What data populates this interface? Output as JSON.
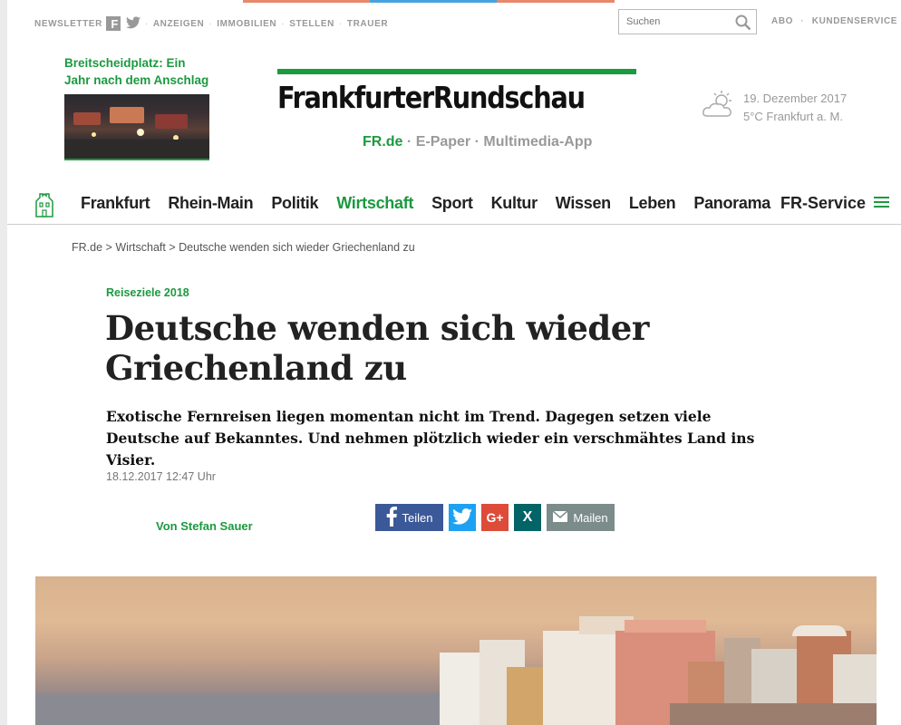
{
  "colors": {
    "accent": "#1b9a3f",
    "facebook": "#3b5998",
    "twitter": "#1da1f2",
    "googleplus": "#dd4b39",
    "xing": "#026466",
    "mail": "#7b8c8a"
  },
  "topbar": {
    "newsletter": "NEWSLETTER",
    "items": [
      "ANZEIGEN",
      "IMMOBILIEN",
      "STELLEN",
      "TRAUER"
    ],
    "search_placeholder": "Suchen",
    "abo": "ABO",
    "kundenservice": "KUNDENSERVICE"
  },
  "teaser": {
    "title": "Breitscheidplatz: Ein Jahr nach dem Anschlag"
  },
  "logo": {
    "name": "FrankfurterRundschau"
  },
  "sublinks": {
    "fr": "FR.de",
    "epaper": "E-Paper",
    "app": "Multimedia-App"
  },
  "weather": {
    "date": "19. Dezember 2017",
    "temp": "5°C Frankfurt a. M.",
    "icon": "partly-cloudy-icon"
  },
  "nav": {
    "items": [
      "Frankfurt",
      "Rhein-Main",
      "Politik",
      "Wirtschaft",
      "Sport",
      "Kultur",
      "Wissen",
      "Leben",
      "Panorama"
    ],
    "active": "Wirtschaft",
    "service": "FR-Service"
  },
  "breadcrumb": {
    "home": "FR.de",
    "section": "Wirtschaft",
    "current": "Deutsche wenden sich wieder Griechenland zu"
  },
  "article": {
    "kicker": "Reiseziele 2018",
    "headline": "Deutsche wenden sich wieder Griechenland zu",
    "intro": "Exotische Fernreisen liegen momentan nicht im Trend. Dagegen setzen viele Deutsche auf Bekanntes. Und nehmen plötzlich wieder ein verschmähtes Land ins Visier.",
    "date": "18.12.2017 12:47 Uhr",
    "author": "Von Stefan Sauer"
  },
  "share": {
    "facebook": "Teilen",
    "googleplus": "G+",
    "xing": "X",
    "mail": "Mailen"
  }
}
